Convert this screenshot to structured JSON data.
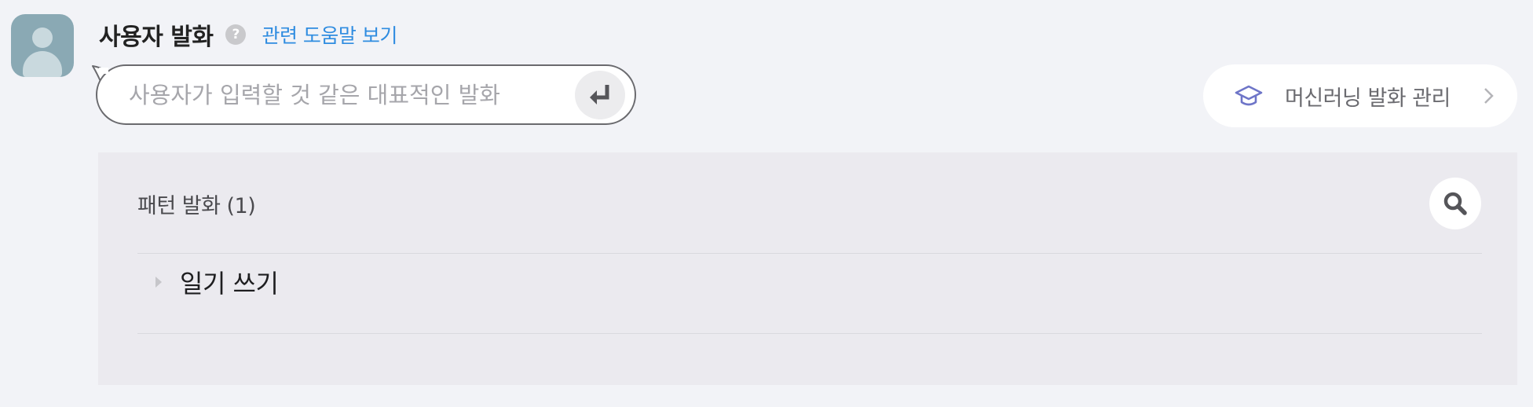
{
  "header": {
    "title": "사용자 발화",
    "help_icon": "question-circle-icon",
    "help_link": "관련 도움말 보기"
  },
  "input": {
    "placeholder": "사용자가 입력할 것 같은 대표적인 발화",
    "value": "",
    "enter_icon": "enter-return-icon"
  },
  "ml_button": {
    "icon": "graduation-cap-icon",
    "label": "머신러닝 발화 관리",
    "chevron_icon": "chevron-right-icon"
  },
  "patterns": {
    "title": "패턴 발화 (1)",
    "search_icon": "search-icon",
    "items": [
      {
        "label": "일기 쓰기",
        "icon": "caret-right-icon"
      }
    ]
  },
  "colors": {
    "background": "#f2f3f7",
    "panel": "#ebeaef",
    "link": "#2f8ce0",
    "accent_icon": "#6e75c8",
    "avatar": "#8aa9b4"
  }
}
